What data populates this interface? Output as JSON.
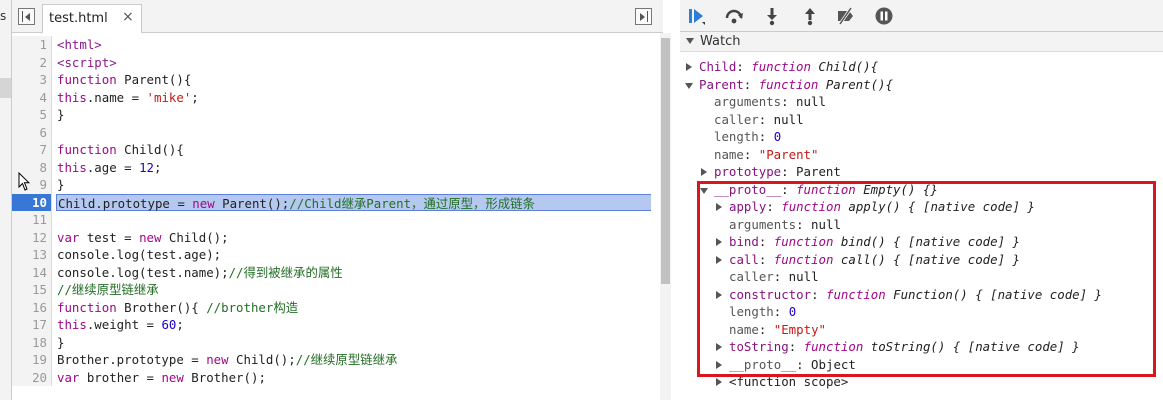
{
  "left_strip": {
    "label": "s"
  },
  "editor": {
    "tab": {
      "filename": "test.html",
      "close": "×"
    },
    "lines": [
      {
        "n": "1",
        "parts": [
          {
            "c": "tag",
            "t": "<html>"
          }
        ]
      },
      {
        "n": "2",
        "parts": [
          {
            "c": "tag",
            "t": "<script>"
          }
        ]
      },
      {
        "n": "3",
        "parts": [
          {
            "c": "kw",
            "t": "function"
          },
          {
            "c": "",
            "t": " Parent(){"
          }
        ]
      },
      {
        "n": "4",
        "parts": [
          {
            "c": "kw",
            "t": "this"
          },
          {
            "c": "",
            "t": ".name = "
          },
          {
            "c": "str",
            "t": "'mike'"
          },
          {
            "c": "",
            "t": ";"
          }
        ]
      },
      {
        "n": "5",
        "parts": [
          {
            "c": "",
            "t": "}"
          }
        ]
      },
      {
        "n": "6",
        "parts": []
      },
      {
        "n": "7",
        "parts": [
          {
            "c": "kw",
            "t": "function"
          },
          {
            "c": "",
            "t": " Child(){"
          }
        ]
      },
      {
        "n": "8",
        "parts": [
          {
            "c": "kw",
            "t": "this"
          },
          {
            "c": "",
            "t": ".age = "
          },
          {
            "c": "num",
            "t": "12"
          },
          {
            "c": "",
            "t": ";"
          }
        ]
      },
      {
        "n": "9",
        "parts": [
          {
            "c": "",
            "t": "}"
          }
        ]
      },
      {
        "n": "10",
        "hl": true,
        "parts": [
          {
            "c": "",
            "t": "Child.prototype = "
          },
          {
            "c": "kw",
            "t": "new"
          },
          {
            "c": "",
            "t": " Parent();"
          },
          {
            "c": "cm",
            "t": "//Child继承Parent，通过原型，形成链条"
          }
        ]
      },
      {
        "n": "11",
        "parts": []
      },
      {
        "n": "12",
        "parts": [
          {
            "c": "kw",
            "t": "var"
          },
          {
            "c": "",
            "t": " test = "
          },
          {
            "c": "kw",
            "t": "new"
          },
          {
            "c": "",
            "t": " Child();"
          }
        ]
      },
      {
        "n": "13",
        "parts": [
          {
            "c": "",
            "t": "console.log(test.age);"
          }
        ]
      },
      {
        "n": "14",
        "parts": [
          {
            "c": "",
            "t": "console.log(test.name);"
          },
          {
            "c": "cm",
            "t": "//得到被继承的属性"
          }
        ]
      },
      {
        "n": "15",
        "parts": [
          {
            "c": "cm",
            "t": "//继续原型链继承"
          }
        ]
      },
      {
        "n": "16",
        "parts": [
          {
            "c": "kw",
            "t": "function"
          },
          {
            "c": "",
            "t": " Brother(){ "
          },
          {
            "c": "cm",
            "t": "//brother构造"
          }
        ]
      },
      {
        "n": "17",
        "parts": [
          {
            "c": "kw",
            "t": "this"
          },
          {
            "c": "",
            "t": ".weight = "
          },
          {
            "c": "num",
            "t": "60"
          },
          {
            "c": "",
            "t": ";"
          }
        ]
      },
      {
        "n": "18",
        "parts": [
          {
            "c": "",
            "t": "}"
          }
        ]
      },
      {
        "n": "19",
        "parts": [
          {
            "c": "",
            "t": "Brother.prototype = "
          },
          {
            "c": "kw",
            "t": "new"
          },
          {
            "c": "",
            "t": " Child();"
          },
          {
            "c": "cm",
            "t": "//继续原型链继承"
          }
        ]
      },
      {
        "n": "20",
        "parts": [
          {
            "c": "kw",
            "t": "var"
          },
          {
            "c": "",
            "t": " brother = "
          },
          {
            "c": "kw",
            "t": "new"
          },
          {
            "c": "",
            "t": " Brother();"
          }
        ]
      }
    ]
  },
  "debugger": {
    "toolbar": {
      "resume": "resume-icon",
      "step_over": "step-over-icon",
      "step_into": "step-into-icon",
      "step_out": "step-out-icon",
      "deactivate": "deactivate-breakpoints-icon",
      "pause_exceptions": "pause-on-exceptions-icon"
    },
    "watch_title": "Watch",
    "watch_rows": [
      {
        "indent": 0,
        "tri": "right",
        "parts": [
          {
            "c": "pk",
            "t": "Child"
          },
          {
            "c": "vn",
            "t": ": "
          },
          {
            "c": "fk",
            "t": "function"
          },
          {
            "c": "fn",
            "t": " Child(){"
          }
        ]
      },
      {
        "indent": 0,
        "tri": "down",
        "parts": [
          {
            "c": "pk",
            "t": "Parent"
          },
          {
            "c": "vn",
            "t": ": "
          },
          {
            "c": "fk",
            "t": "function"
          },
          {
            "c": "fn",
            "t": " Parent(){"
          }
        ]
      },
      {
        "indent": 1,
        "tri": "",
        "parts": [
          {
            "c": "pn",
            "t": "arguments"
          },
          {
            "c": "vn",
            "t": ": null"
          }
        ]
      },
      {
        "indent": 1,
        "tri": "",
        "parts": [
          {
            "c": "pn",
            "t": "caller"
          },
          {
            "c": "vn",
            "t": ": null"
          }
        ]
      },
      {
        "indent": 1,
        "tri": "",
        "parts": [
          {
            "c": "pn",
            "t": "length"
          },
          {
            "c": "vn",
            "t": ": "
          },
          {
            "c": "vnum",
            "t": "0"
          }
        ]
      },
      {
        "indent": 1,
        "tri": "",
        "parts": [
          {
            "c": "pn",
            "t": "name"
          },
          {
            "c": "vn",
            "t": ": "
          },
          {
            "c": "vs",
            "t": "\"Parent\""
          }
        ]
      },
      {
        "indent": 1,
        "tri": "right",
        "parts": [
          {
            "c": "pk",
            "t": "prototype"
          },
          {
            "c": "vn",
            "t": ": Parent"
          }
        ]
      },
      {
        "indent": 1,
        "tri": "down",
        "parts": [
          {
            "c": "pk",
            "t": "__proto__"
          },
          {
            "c": "vn",
            "t": ": "
          },
          {
            "c": "fk",
            "t": "function"
          },
          {
            "c": "fn",
            "t": " Empty() {}"
          }
        ]
      },
      {
        "indent": 2,
        "tri": "right",
        "parts": [
          {
            "c": "pk",
            "t": "apply"
          },
          {
            "c": "vn",
            "t": ": "
          },
          {
            "c": "fk",
            "t": "function"
          },
          {
            "c": "fn",
            "t": " apply() { [native code] }"
          }
        ]
      },
      {
        "indent": 2,
        "tri": "",
        "parts": [
          {
            "c": "pn",
            "t": "arguments"
          },
          {
            "c": "vn",
            "t": ": null"
          }
        ]
      },
      {
        "indent": 2,
        "tri": "right",
        "parts": [
          {
            "c": "pk",
            "t": "bind"
          },
          {
            "c": "vn",
            "t": ": "
          },
          {
            "c": "fk",
            "t": "function"
          },
          {
            "c": "fn",
            "t": " bind() { [native code] }"
          }
        ]
      },
      {
        "indent": 2,
        "tri": "right",
        "parts": [
          {
            "c": "pk",
            "t": "call"
          },
          {
            "c": "vn",
            "t": ": "
          },
          {
            "c": "fk",
            "t": "function"
          },
          {
            "c": "fn",
            "t": " call() { [native code] }"
          }
        ]
      },
      {
        "indent": 2,
        "tri": "",
        "parts": [
          {
            "c": "pn",
            "t": "caller"
          },
          {
            "c": "vn",
            "t": ": null"
          }
        ]
      },
      {
        "indent": 2,
        "tri": "right",
        "parts": [
          {
            "c": "pk",
            "t": "constructor"
          },
          {
            "c": "vn",
            "t": ": "
          },
          {
            "c": "fk",
            "t": "function"
          },
          {
            "c": "fn",
            "t": " Function() { [native code] }"
          }
        ]
      },
      {
        "indent": 2,
        "tri": "",
        "parts": [
          {
            "c": "pn",
            "t": "length"
          },
          {
            "c": "vn",
            "t": ": "
          },
          {
            "c": "vnum",
            "t": "0"
          }
        ]
      },
      {
        "indent": 2,
        "tri": "",
        "parts": [
          {
            "c": "pn",
            "t": "name"
          },
          {
            "c": "vn",
            "t": ": "
          },
          {
            "c": "vs",
            "t": "\"Empty\""
          }
        ]
      },
      {
        "indent": 2,
        "tri": "right",
        "parts": [
          {
            "c": "pk",
            "t": "toString"
          },
          {
            "c": "vn",
            "t": ": "
          },
          {
            "c": "fk",
            "t": "function"
          },
          {
            "c": "fn",
            "t": " toString() { [native code] }"
          }
        ]
      },
      {
        "indent": 2,
        "tri": "right",
        "parts": [
          {
            "c": "pn",
            "t": "__proto__"
          },
          {
            "c": "vn",
            "t": ": Object"
          }
        ]
      },
      {
        "indent": 2,
        "tri": "right",
        "parts": [
          {
            "c": "vn",
            "t": "<function scope>"
          }
        ]
      }
    ]
  },
  "colors": {
    "highlight_line": "#b4c8f0",
    "gutter_active": "#3877d6",
    "annotation_box": "#d9161d",
    "debug_blue": "#2d7cd6"
  }
}
